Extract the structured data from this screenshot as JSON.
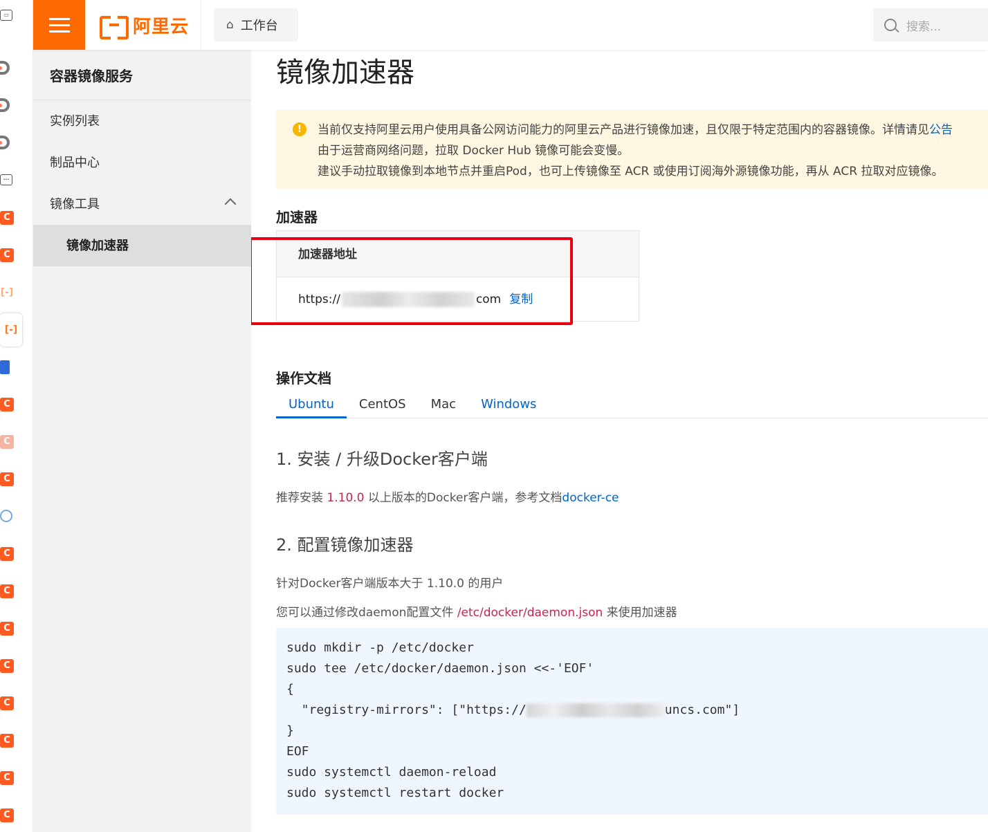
{
  "topbar": {
    "logo_text": "阿里云",
    "workbench_label": "工作台",
    "search_placeholder": "搜索..."
  },
  "sidebar": {
    "title": "容器镜像服务",
    "items": [
      {
        "label": "实例列表"
      },
      {
        "label": "制品中心"
      },
      {
        "label": "镜像工具"
      },
      {
        "label": "镜像加速器"
      }
    ]
  },
  "main": {
    "page_title": "镜像加速器",
    "notice": {
      "line1": "当前仅支持阿里云用户使用具备公网访问能力的阿里云产品进行镜像加速，且仅限于特定范围内的容器镜像。详情请见",
      "line1_link": "公告",
      "line2": "由于运营商网络问题，拉取 Docker Hub 镜像可能会变慢。",
      "line3": "建议手动拉取镜像到本地节点并重启Pod，也可上传镜像至 ACR 或使用订阅海外源镜像功能，再从 ACR 拉取对应镜像。"
    },
    "accelerator": {
      "section_title": "加速器",
      "column_header": "加速器地址",
      "url_prefix": "https://",
      "url_suffix": "com",
      "copy_label": "复制"
    },
    "docs": {
      "section_title": "操作文档",
      "tabs": [
        "Ubuntu",
        "CentOS",
        "Mac",
        "Windows"
      ],
      "step1_title": "1. 安装 / 升级Docker客户端",
      "step1_text_a": "推荐安装 ",
      "step1_version": "1.10.0",
      "step1_text_b": " 以上版本的Docker客户端，参考文档",
      "step1_link": "docker-ce",
      "step2_title": "2. 配置镜像加速器",
      "step2_text1": "针对Docker客户端版本大于 1.10.0 的用户",
      "step2_text2_a": "您可以通过修改daemon配置文件 ",
      "step2_path": "/etc/docker/daemon.json",
      "step2_text2_b": " 来使用加速器",
      "code_lines": [
        "sudo mkdir -p /etc/docker",
        "sudo tee /etc/docker/daemon.json <<-'EOF'",
        "{",
        "  \"registry-mirrors\": [\"https://",
        "}",
        "EOF",
        "sudo systemctl daemon-reload",
        "sudo systemctl restart docker"
      ],
      "code_line4_suffix": "uncs.com\"]"
    }
  },
  "colors": {
    "brand": "#ff6a00",
    "link": "#0064c8",
    "highlight_box": "#e60012",
    "notice_bg": "#fff7e1"
  }
}
